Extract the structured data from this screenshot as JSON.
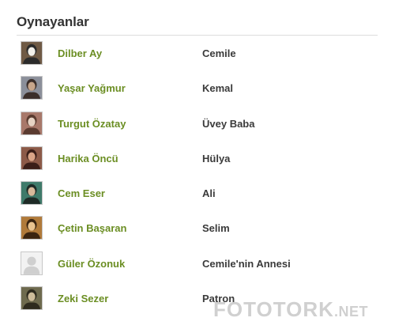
{
  "section": {
    "title": "Oynayanlar"
  },
  "cast": [
    {
      "actor": "Dilber Ay",
      "role": "Cemile",
      "avatar": "photo",
      "colors": [
        "#6f5a45",
        "#f2f0ea",
        "#2b2b2b"
      ]
    },
    {
      "actor": "Yaşar Yağmur",
      "role": "Kemal",
      "avatar": "photo",
      "colors": [
        "#8b8f9a",
        "#c7a58a",
        "#3b2e2a"
      ]
    },
    {
      "actor": "Turgut Özatay",
      "role": "Üvey Baba",
      "avatar": "photo",
      "colors": [
        "#a8786a",
        "#e6d3c4",
        "#5a3b30"
      ]
    },
    {
      "actor": "Harika Öncü",
      "role": "Hülya",
      "avatar": "photo",
      "colors": [
        "#8c5a48",
        "#d9a487",
        "#3a1e18"
      ]
    },
    {
      "actor": "Cem Eser",
      "role": "Ali",
      "avatar": "photo",
      "colors": [
        "#3f7a6a",
        "#d8b89a",
        "#1e2a26"
      ]
    },
    {
      "actor": "Çetin Başaran",
      "role": "Selim",
      "avatar": "photo",
      "colors": [
        "#b07a3a",
        "#e9c38f",
        "#3a2410"
      ]
    },
    {
      "actor": "Güler Özonuk",
      "role": "Cemile'nin Annesi",
      "avatar": "placeholder",
      "colors": [
        "#d4d4d4",
        "#ffffff",
        "#d4d4d4"
      ]
    },
    {
      "actor": "Zeki Sezer",
      "role": "Patron",
      "avatar": "photo",
      "colors": [
        "#6e6a4e",
        "#cdbb9a",
        "#2e2a1e"
      ]
    }
  ],
  "watermark": {
    "main": "FOTOTORK",
    "suffix": ".NET"
  }
}
